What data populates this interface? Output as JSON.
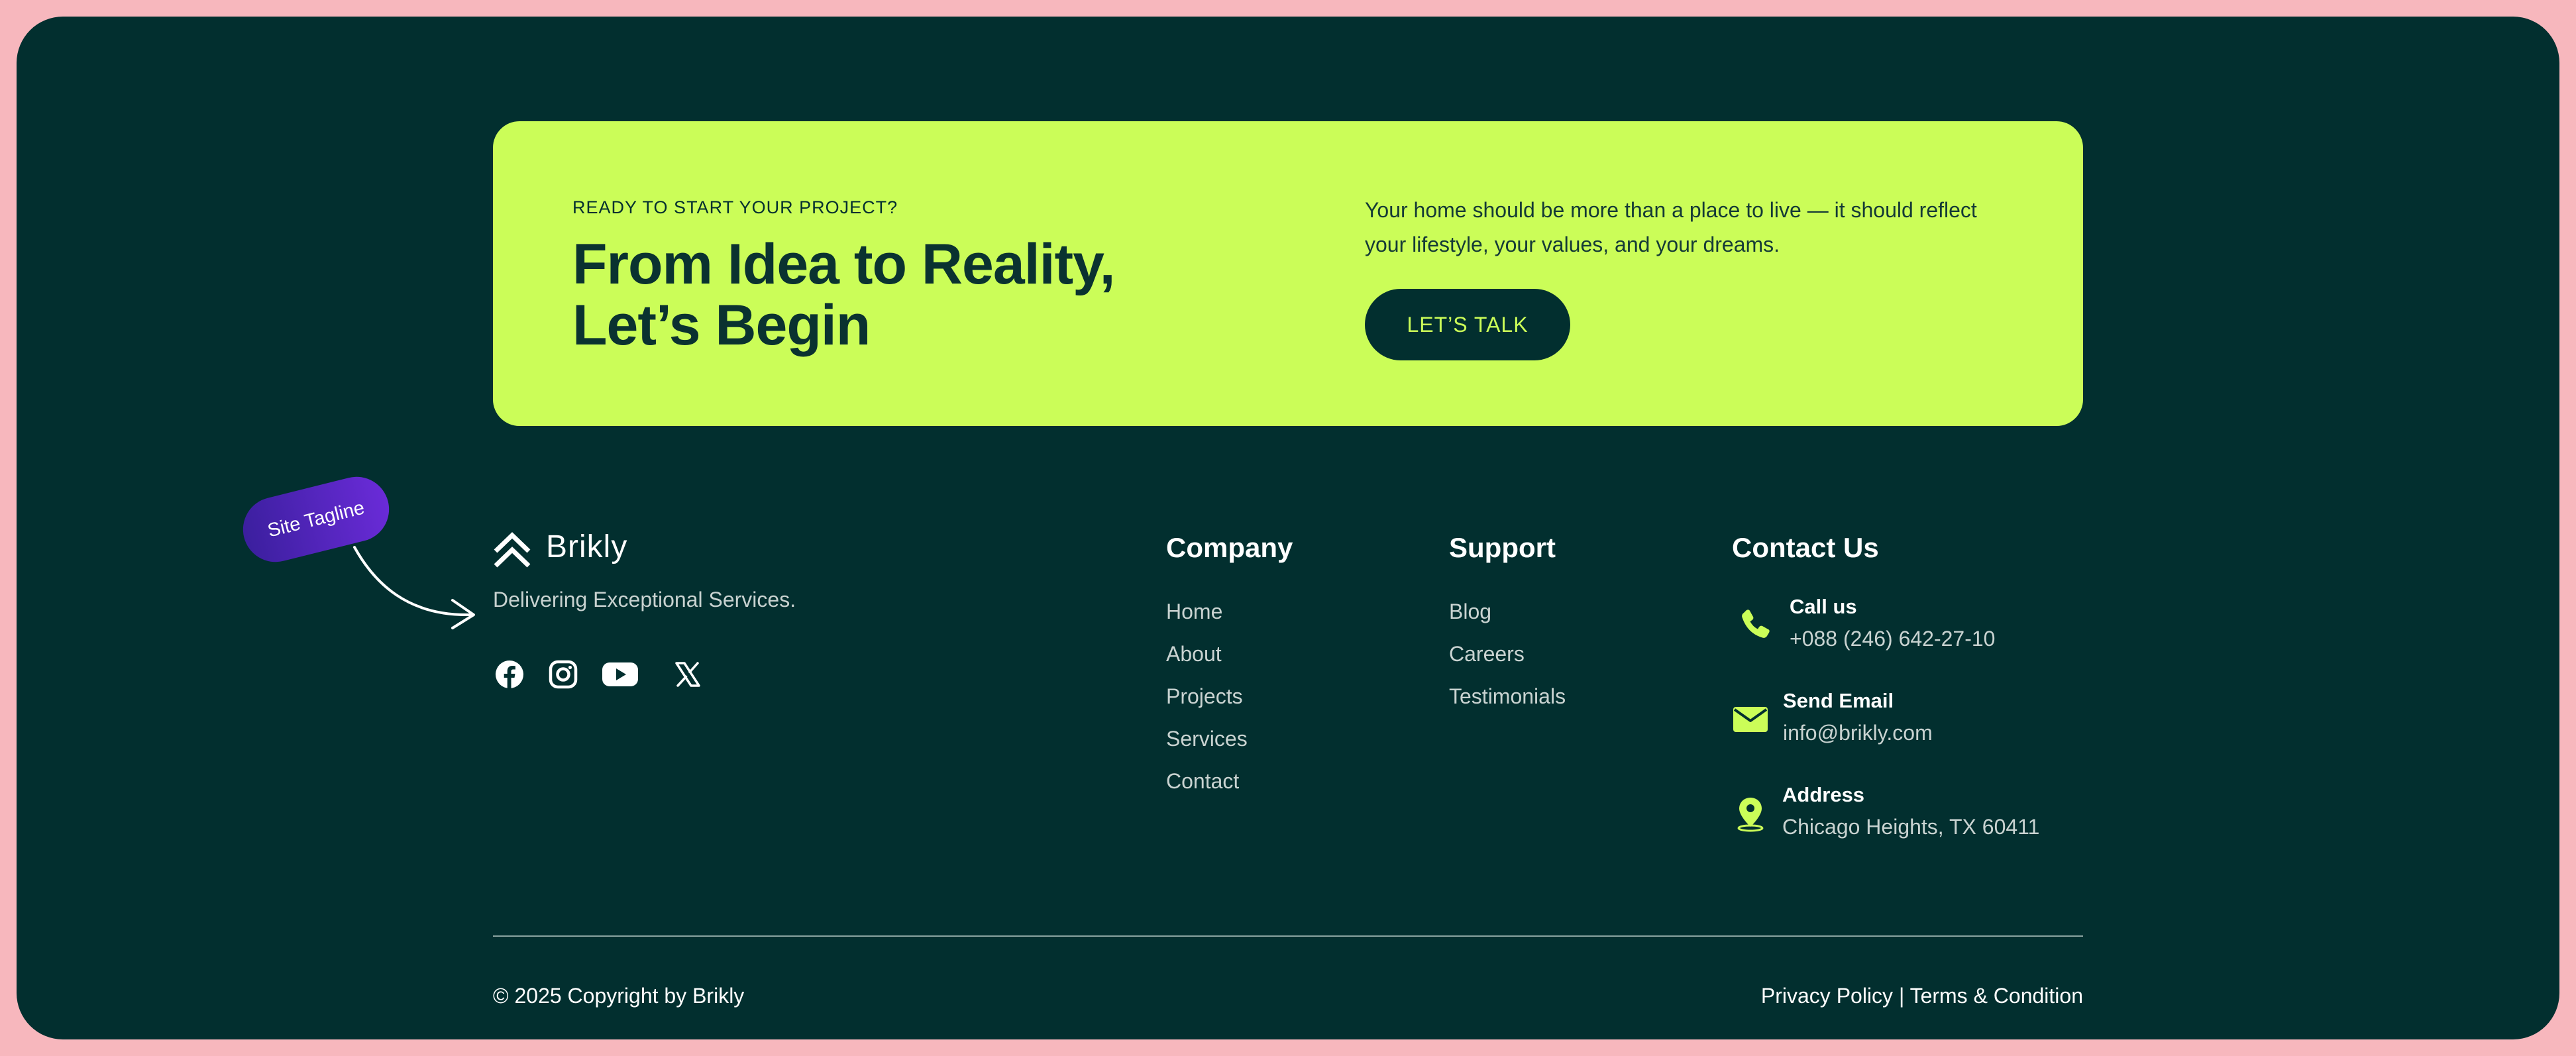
{
  "cta": {
    "eyebrow": "READY TO START YOUR PROJECT?",
    "title_line1": "From Idea to Reality,",
    "title_line2": "Let’s Begin",
    "text": "Your home should be more than a place to live — it should reflect your lifestyle, your values, and your dreams.",
    "button_label": "LET’S TALK"
  },
  "brand": {
    "name": "Brikly",
    "tagline": "Delivering Exceptional Services.",
    "social_icons": [
      "facebook-icon",
      "instagram-icon",
      "youtube-icon",
      "x-icon"
    ]
  },
  "annotation": {
    "label": "Site Tagline"
  },
  "company": {
    "title": "Company",
    "links": [
      "Home",
      "About",
      "Projects",
      "Services",
      "Contact"
    ]
  },
  "support": {
    "title": "Support",
    "links": [
      "Blog",
      "Careers",
      "Testimonials"
    ]
  },
  "contact": {
    "title": "Contact Us",
    "items": [
      {
        "icon": "phone-icon",
        "label": "Call us",
        "value": "+088 (246) 642-27-10"
      },
      {
        "icon": "envelope-icon",
        "label": "Send Email",
        "value": "info@brikly.com"
      },
      {
        "icon": "map-pin-icon",
        "label": "Address",
        "value": "Chicago Heights, TX 60411"
      }
    ]
  },
  "footer": {
    "copyright": "© 2025 Copyright by Brikly",
    "privacy": "Privacy Policy",
    "separator": " | ",
    "terms": "Terms & Condition"
  },
  "colors": {
    "background": "#022f2f",
    "accent": "#cbfd58",
    "frame": "#f7b7bd",
    "badge": "#5a27c8"
  }
}
